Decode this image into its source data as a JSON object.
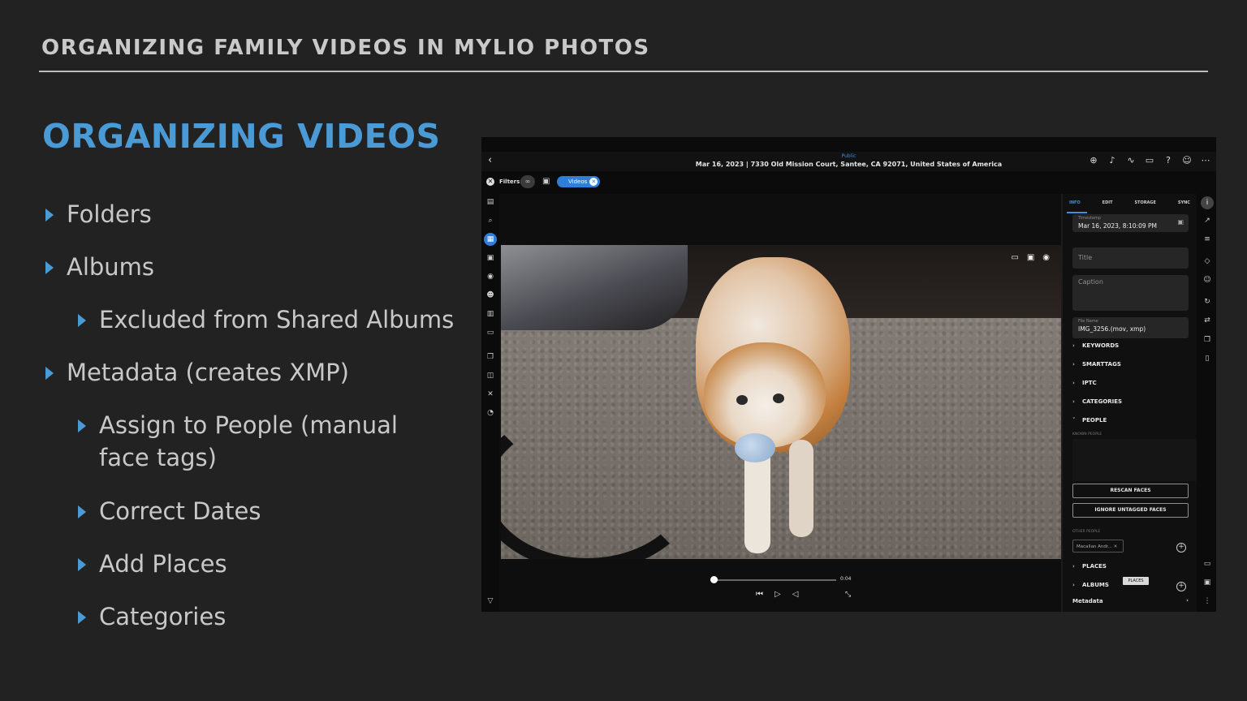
{
  "slide": {
    "header": "ORGANIZING FAMILY VIDEOS IN MYLIO PHOTOS",
    "title": "ORGANIZING VIDEOS",
    "bullets": [
      {
        "text": "Folders"
      },
      {
        "text": "Albums"
      },
      {
        "text": "Excluded from Shared Albums"
      },
      {
        "text": "Metadata (creates XMP)"
      },
      {
        "text": "Assign to People (manual face tags)"
      },
      {
        "text": "Correct Dates"
      },
      {
        "text": "Add Places"
      },
      {
        "text": "Categories"
      }
    ],
    "accent": "#4a9ad6"
  },
  "app": {
    "top_bar": {
      "visibility": "Public",
      "info": "Mar 16, 2023 | 7330 Old Mission Court, Santee, CA 92071, United States of America",
      "icons": [
        "add-icon",
        "bell-icon",
        "activity-icon",
        "devices-icon",
        "help-icon",
        "account-icon",
        "more-icon"
      ]
    },
    "filters": {
      "label": "Filters:",
      "chip_label": "Videos"
    },
    "player": {
      "time": "0:04",
      "progress": 0.02
    },
    "panel": {
      "tabs": [
        "INFO",
        "EDIT",
        "STORAGE",
        "SYNC"
      ],
      "active_tab": "INFO",
      "timestamp_label": "Timestamp",
      "timestamp_value": "Mar 16, 2023, 8:10:09 PM",
      "title_placeholder": "Title",
      "caption_placeholder": "Caption",
      "filename_label": "File Name",
      "filename_value": "IMG_3256.(mov, xmp)",
      "sections": {
        "keywords": "KEYWORDS",
        "smarttags": "SMARTTAGS",
        "iptc": "IPTC",
        "categories": "CATEGORIES",
        "people": "PEOPLE",
        "places": "PLACES",
        "albums": "ALBUMS"
      },
      "known_people_label": "KNOWN PEOPLE",
      "rescan_button": "RESCAN FACES",
      "ignore_button": "IGNORE UNTAGGED FACES",
      "other_people_label": "OTHER PEOPLE",
      "person_tag": "Macallan Andr...",
      "places_badge": "PLACES",
      "metadata_label": "Metadata"
    }
  }
}
